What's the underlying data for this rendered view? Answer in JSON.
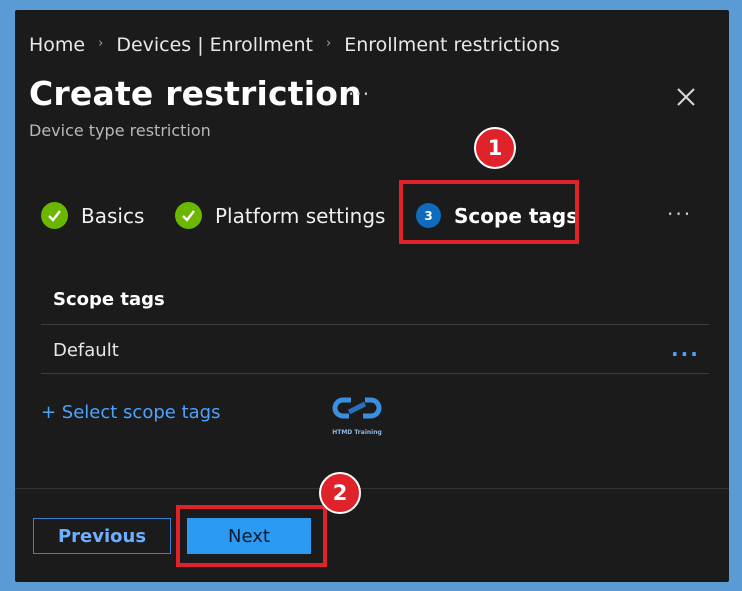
{
  "breadcrumb": [
    "Home",
    "Devices | Enrollment",
    "Enrollment restrictions"
  ],
  "header": {
    "title": "Create restriction",
    "more": "···",
    "subtitle": "Device type restriction"
  },
  "steps": [
    {
      "label": "Basics",
      "state": "complete"
    },
    {
      "label": "Platform settings",
      "state": "complete"
    },
    {
      "number": "3",
      "label": "Scope tags",
      "state": "active"
    }
  ],
  "steps_more": "···",
  "scope_tags": {
    "heading": "Scope tags",
    "rows": [
      "Default"
    ],
    "row_more": "···",
    "add_link": "+ Select scope tags"
  },
  "watermark": {
    "text": "HTMD Training"
  },
  "annotations": {
    "badge1": "1",
    "badge2": "2"
  },
  "footer": {
    "previous": "Previous",
    "next": "Next"
  },
  "colors": {
    "background": "#1b1b1b",
    "frame": "#5a9bd5",
    "accent": "#2b9af3",
    "success": "#6bb700",
    "highlight": "#e0232b"
  }
}
